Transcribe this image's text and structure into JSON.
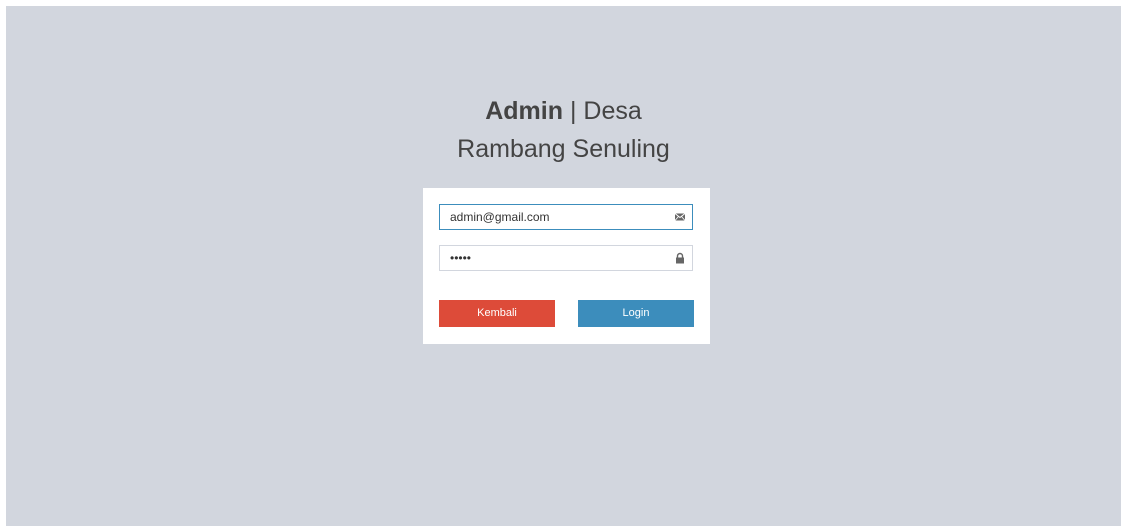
{
  "header": {
    "title_bold": "Admin",
    "title_rest": " | Desa",
    "subtitle": "Rambang Senuling"
  },
  "form": {
    "email_value": "admin@gmail.com",
    "email_icon": "envelope-icon",
    "password_value": "•••••",
    "password_icon": "lock-icon",
    "back_label": "Kembali",
    "login_label": "Login"
  },
  "colors": {
    "background": "#d2d6de",
    "back_button": "#dd4b39",
    "login_button": "#3c8dbc"
  }
}
